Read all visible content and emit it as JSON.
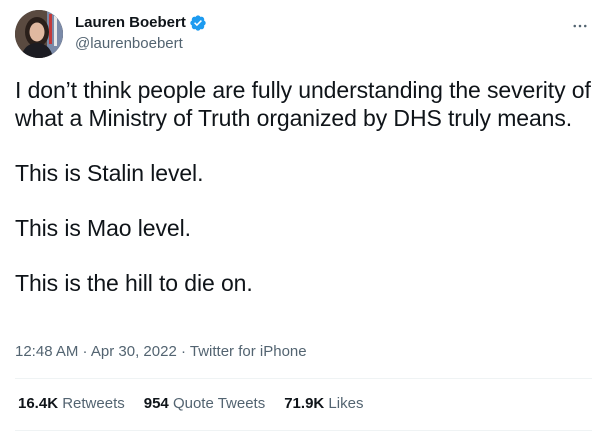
{
  "author": {
    "display_name": "Lauren Boebert",
    "handle": "@laurenboebert",
    "verified": true
  },
  "icons": {
    "verified": "verified-badge-icon",
    "more": "more-horizontal-icon",
    "verified_color": "#1d9bf0"
  },
  "tweet": {
    "paragraphs": [
      "I don’t think people are fully understanding the severity of what a Ministry of Truth organized by DHS truly means.",
      "This is Stalin level.",
      "This is Mao level.",
      "This is the hill to die on."
    ]
  },
  "meta": {
    "time": "12:48 AM",
    "separator": " · ",
    "date": "Apr 30, 2022",
    "source": "Twitter for iPhone"
  },
  "stats": {
    "retweets": {
      "count": "16.4K",
      "label": "Retweets"
    },
    "quote_tweets": {
      "count": "954",
      "label": "Quote Tweets"
    },
    "likes": {
      "count": "71.9K",
      "label": "Likes"
    }
  }
}
